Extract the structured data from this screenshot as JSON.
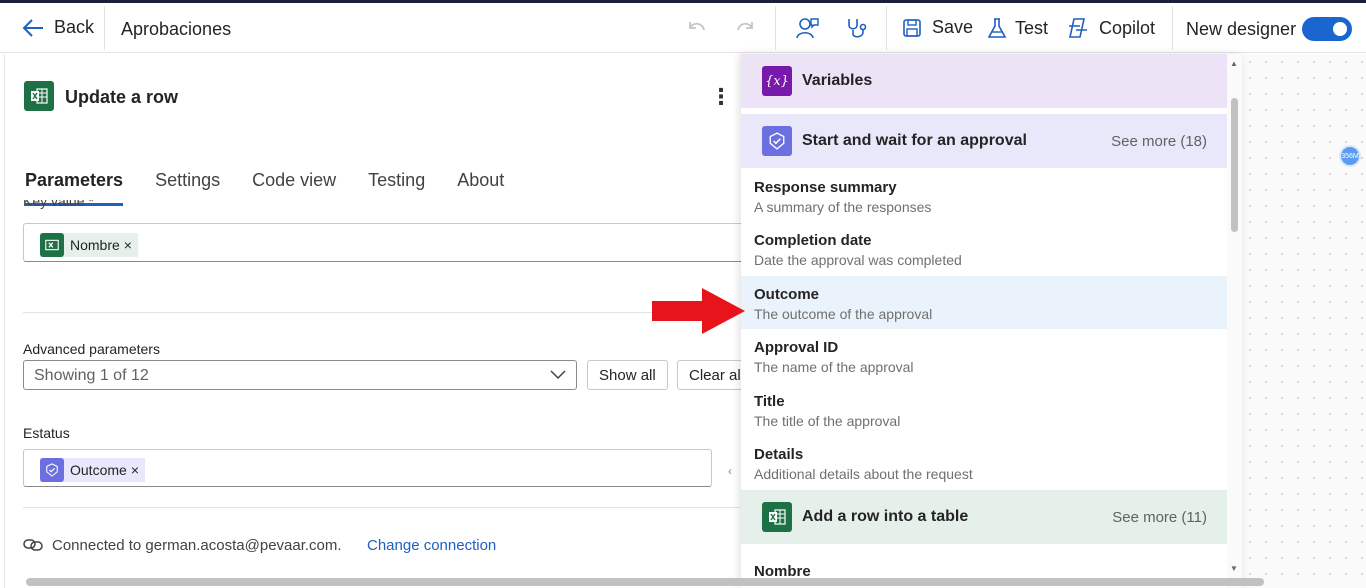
{
  "topbar": {
    "back_label": "Back",
    "flow_name": "Aprobaciones",
    "save_label": "Save",
    "test_label": "Test",
    "copilot_label": "Copilot",
    "new_designer_label": "New designer",
    "new_designer_on": true
  },
  "action": {
    "title": "Update a row",
    "tabs": [
      "Parameters",
      "Settings",
      "Code view",
      "Testing",
      "About"
    ],
    "active_tab": "Parameters",
    "key_value_label": "Key value *",
    "key_value_token": "Nombre",
    "advanced_label": "Advanced parameters",
    "advanced_dropdown_value": "Showing 1 of 12",
    "show_all_label": "Show all",
    "clear_all_label": "Clear all",
    "estatus_label": "Estatus",
    "estatus_token": "Outcome",
    "token_remove": "×",
    "connection_text": "Connected to german.acosta@pevaar.com.",
    "change_connection_label": "Change connection"
  },
  "dynamic_content": {
    "variables_title": "Variables",
    "variables_icon": "{x}",
    "approval_section": {
      "title": "Start and wait for an approval",
      "see_more": "See more (18)",
      "items": [
        {
          "title": "Response summary",
          "desc": "A summary of the responses"
        },
        {
          "title": "Completion date",
          "desc": "Date the approval was completed"
        },
        {
          "title": "Outcome",
          "desc": "The outcome of the approval"
        },
        {
          "title": "Approval ID",
          "desc": "The name of the approval"
        },
        {
          "title": "Title",
          "desc": "The title of the approval"
        },
        {
          "title": "Details",
          "desc": "Additional details about the request"
        }
      ]
    },
    "excel_section": {
      "title": "Add a row into a table",
      "see_more": "See more (11)",
      "items": [
        {
          "title": "Nombre"
        }
      ]
    }
  },
  "canvas": {
    "badge": "356M"
  },
  "colors": {
    "accent": "#1f5fbf",
    "excel_green": "#1e7145",
    "approval_purple": "#6b6fe0",
    "variables_purple": "#7719aa",
    "highlight_row": "#eaf3fb",
    "annotation_arrow": "#e8141b"
  }
}
